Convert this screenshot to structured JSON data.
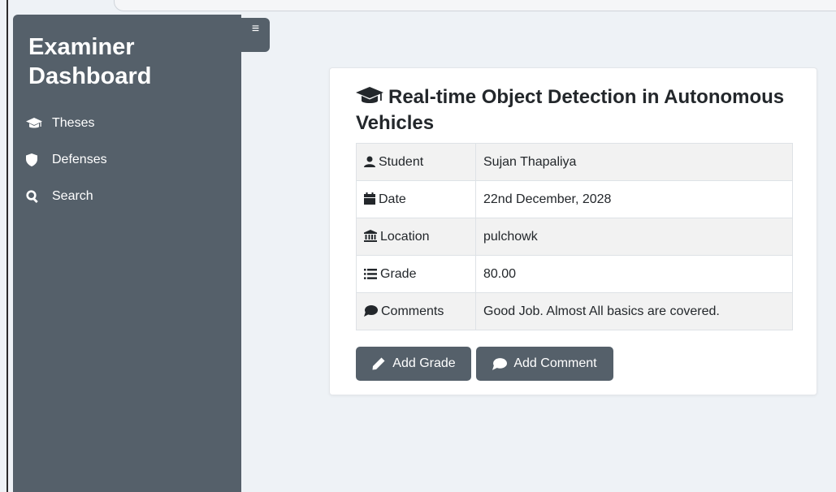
{
  "sidebar": {
    "title": "Examiner Dashboard",
    "items": [
      {
        "label": "Theses",
        "icon": "graduation-cap-icon"
      },
      {
        "label": "Defenses",
        "icon": "shield-icon"
      },
      {
        "label": "Search",
        "icon": "search-icon"
      }
    ],
    "toggle_label": "≡"
  },
  "thesis": {
    "title": "Real-time Object Detection in Autonomous Vehicles",
    "rows": [
      {
        "key": "Student",
        "value": "Sujan Thapaliya",
        "icon": "user-icon"
      },
      {
        "key": "Date",
        "value": "22nd December, 2028",
        "icon": "calendar-icon"
      },
      {
        "key": "Location",
        "value": "pulchowk",
        "icon": "building-icon"
      },
      {
        "key": "Grade",
        "value": "80.00",
        "icon": "list-icon"
      },
      {
        "key": "Comments",
        "value": "Good Job. Almost All basics are covered.",
        "icon": "comment-icon"
      }
    ]
  },
  "actions": {
    "add_grade": "Add Grade",
    "add_comment": "Add Comment"
  },
  "colors": {
    "sidebar_bg": "#55606a",
    "page_bg": "#eef2f6",
    "card_bg": "#ffffff"
  }
}
